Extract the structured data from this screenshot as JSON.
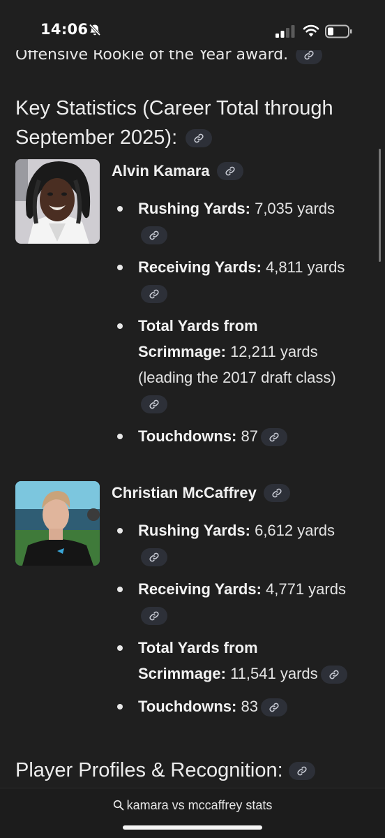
{
  "status_bar": {
    "time": "14:06"
  },
  "content": {
    "cut_off_text": "Offensive Rookie of the Year award.",
    "key_stats_heading": "Key Statistics (Career Total through September 2025):",
    "players": [
      {
        "name": "Alvin Kamara",
        "stats": [
          {
            "label": "Rushing Yards:",
            "value": " 7,035 yards"
          },
          {
            "label": "Receiving Yards:",
            "value": " 4,811 yards"
          },
          {
            "label": "Total Yards from Scrimmage:",
            "value": " 12,211 yards (leading the 2017 draft class)"
          },
          {
            "label": "Touchdowns:",
            "value": " 87"
          }
        ]
      },
      {
        "name": "Christian McCaffrey",
        "stats": [
          {
            "label": "Rushing Yards:",
            "value": " 6,612 yards"
          },
          {
            "label": "Receiving Yards:",
            "value": " 4,771 yards"
          },
          {
            "label": "Total Yards from Scrimmage:",
            "value": " 11,541 yards"
          },
          {
            "label": "Touchdowns:",
            "value": " 83"
          }
        ]
      }
    ],
    "profiles_heading": "Player Profiles & Recognition:"
  },
  "bottom_bar": {
    "query": "kamara vs mccaffrey stats"
  },
  "colors": {
    "background": "#1f1f1f",
    "chip": "#2d3038",
    "text": "#e8e8e8"
  },
  "icons": [
    "bell-slash-icon",
    "signal-icon",
    "wifi-icon",
    "battery-icon",
    "link-icon",
    "search-icon"
  ]
}
